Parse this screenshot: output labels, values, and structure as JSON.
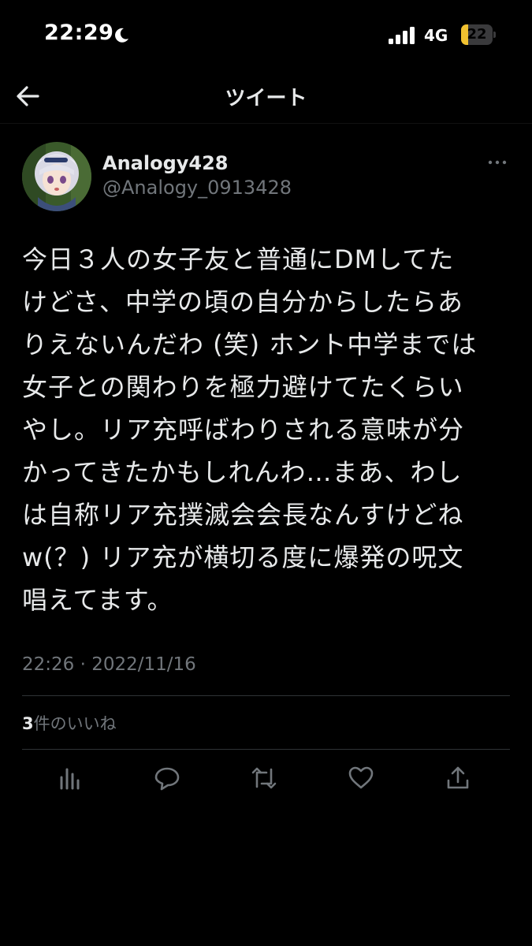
{
  "status_bar": {
    "time": "22:29",
    "network": "4G",
    "battery_level": "22",
    "battery_fraction": 0.22,
    "battery_color": "#f2c230"
  },
  "header": {
    "title": "ツイート",
    "back_icon": "back-arrow-icon"
  },
  "tweet": {
    "author": {
      "display_name": "Analogy428",
      "handle": "@Analogy_0913428"
    },
    "text": "今日３人の女子友と普通にDMしてた\nけどさ、中学の頃の自分からしたらあ\nりえないんだわ (笑) ホント中学までは\n女子との関わりを極力避けてたくらい\nやし。リア充呼ばわりされる意味が分\nかってきたかもしれんわ…まあ、わし\nは自称リア充撲滅会会長なんすけどね\nw(？) リア充が横切る度に爆発の呪文\n唱えてます。",
    "timestamp": "22:26 · 2022/11/16",
    "likes_count": "3",
    "likes_label": "件のいいね"
  },
  "actions": [
    {
      "name": "analytics-icon"
    },
    {
      "name": "reply-icon"
    },
    {
      "name": "retweet-icon"
    },
    {
      "name": "like-icon"
    },
    {
      "name": "share-icon"
    }
  ],
  "colors": {
    "background": "#000000",
    "text_primary": "#e7e9ea",
    "text_secondary": "#71767b",
    "divider": "#2f3336"
  }
}
